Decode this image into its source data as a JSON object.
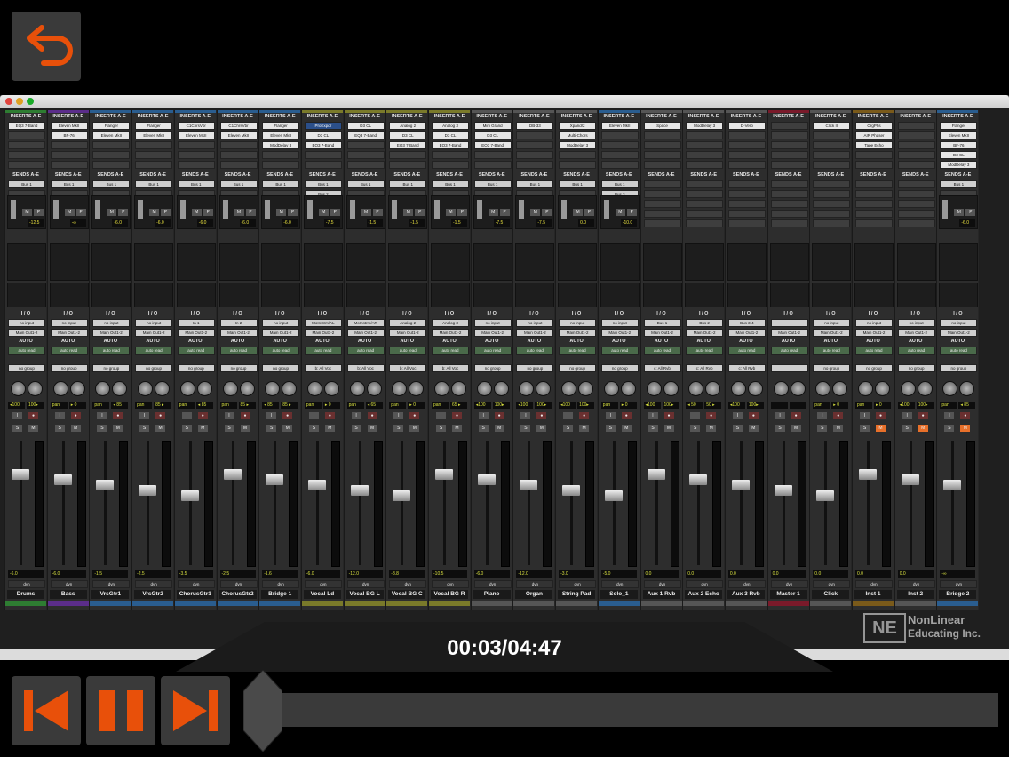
{
  "back_button": {
    "icon": "back-arrow-icon"
  },
  "mixer": {
    "insert_header": "INSERTS A-E",
    "sends_header": "SENDS A-E",
    "io_header": "I / O",
    "auto_header": "AUTO",
    "channels": [
      {
        "name": "Drums",
        "color": "#2e7d32",
        "inserts": [
          "EQ3 7-Band"
        ],
        "sends": [
          "Bus 1"
        ],
        "send_level": "-12.5",
        "input": "no input",
        "output": "Main Out1-2",
        "auto": "auto read",
        "group": "no group",
        "pan": [
          "◂100",
          "100▸"
        ],
        "vol": "-6.0",
        "mute_on": false
      },
      {
        "name": "Bass",
        "color": "#5b2d8a",
        "inserts": [
          "Eleven MkII",
          "BF-76"
        ],
        "sends": [
          "Bus 1"
        ],
        "send_level": "-∞",
        "input": "no input",
        "output": "Main Out1-2",
        "auto": "auto read",
        "group": "no group",
        "pan": [
          "pan",
          "▸ 0"
        ],
        "vol": "-6.0",
        "mute_on": false
      },
      {
        "name": "VrsGtr1",
        "color": "#2a5d8f",
        "inserts": [
          "Flanger",
          "Eleven MkII"
        ],
        "sends": [
          "Bus 1"
        ],
        "send_level": "-6.0",
        "input": "no input",
        "output": "Main Out1-2",
        "auto": "auto read",
        "group": "no group",
        "pan": [
          "pan",
          "◂ 85"
        ],
        "vol": "-1.5",
        "mute_on": false
      },
      {
        "name": "VrsGtr2",
        "color": "#2a5d8f",
        "inserts": [
          "Flanger",
          "Eleven MkII"
        ],
        "sends": [
          "Bus 1"
        ],
        "send_level": "-6.0",
        "input": "no input",
        "output": "Main Out1-2",
        "auto": "auto read",
        "group": "no group",
        "pan": [
          "pan",
          "85 ▸"
        ],
        "vol": "-2.5",
        "mute_on": false
      },
      {
        "name": "ChorusGtr1",
        "color": "#2a5d8f",
        "inserts": [
          "C1ChrsVbr",
          "Eleven MkII"
        ],
        "sends": [
          "Bus 1"
        ],
        "send_level": "-6.0",
        "input": "In 1",
        "output": "Main Out1-2",
        "auto": "auto read",
        "group": "no group",
        "pan": [
          "pan",
          "◂ 85"
        ],
        "vol": "-3.5",
        "mute_on": false
      },
      {
        "name": "ChorusGtr2",
        "color": "#2a5d8f",
        "inserts": [
          "C1ChrsVbr",
          "Eleven MkII"
        ],
        "sends": [
          "Bus 1"
        ],
        "send_level": "-6.0",
        "input": "In 2",
        "output": "Main Out1-2",
        "auto": "auto read",
        "group": "no group",
        "pan": [
          "pan",
          "85 ▸"
        ],
        "vol": "-2.5",
        "mute_on": false
      },
      {
        "name": "Bridge 1",
        "color": "#2a5d8f",
        "inserts": [
          "Flanger",
          "Eleven MkII",
          "ModDelay 3"
        ],
        "sends": [
          "Bus 1"
        ],
        "send_level": "-6.0",
        "input": "no input",
        "output": "Main Out1-2",
        "auto": "auto read",
        "group": "no group",
        "pan": [
          "◂ 85",
          "85 ▸"
        ],
        "vol": "-1.6",
        "mute_on": false
      },
      {
        "name": "Vocal Ld",
        "color": "#7a7a2a",
        "inserts": [
          "ProExpdr",
          "D3 CL",
          "EQ3 7-Band"
        ],
        "sends": [
          "Bus 1",
          "Bus 2"
        ],
        "send_level": "-7.5",
        "input": "MoInstrm/AL",
        "output": "Main Out1-2",
        "auto": "auto read",
        "group": "b: All Voc",
        "pan": [
          "pan",
          "▸ 0"
        ],
        "vol": "-6.0",
        "mute_on": false
      },
      {
        "name": "Vocal BG L",
        "color": "#7a7a2a",
        "inserts": [
          "D3 CL",
          "EQ3 7-Band"
        ],
        "sends": [
          "Bus 1"
        ],
        "send_level": "-1.5",
        "input": "MoInstrm/AR",
        "output": "Main Out1-2",
        "auto": "auto read",
        "group": "b: All Voc",
        "pan": [
          "pan",
          "◂ 65"
        ],
        "vol": "-12.0",
        "mute_on": false
      },
      {
        "name": "Vocal BG C",
        "color": "#7a7a2a",
        "inserts": [
          "Analog 2",
          "D3 CL",
          "EQ3 7-Band"
        ],
        "sends": [
          "Bus 1"
        ],
        "send_level": "-1.5",
        "input": "Analog 2",
        "output": "Main Out1-2",
        "auto": "auto read",
        "group": "b: All Voc",
        "pan": [
          "pan",
          "▸ 0"
        ],
        "vol": "-8.8",
        "mute_on": false
      },
      {
        "name": "Vocal BG R",
        "color": "#7a7a2a",
        "inserts": [
          "Analog 3",
          "D3 CL",
          "EQ3 7-Band"
        ],
        "sends": [
          "Bus 1"
        ],
        "send_level": "-1.5",
        "input": "Analog 3",
        "output": "Main Out1-2",
        "auto": "auto read",
        "group": "b: All Voc",
        "pan": [
          "pan",
          "65 ▸"
        ],
        "vol": "-10.5",
        "mute_on": false
      },
      {
        "name": "Piano",
        "color": "#555555",
        "inserts": [
          "Mini Grand",
          "D3 CL",
          "EQ3 7-Band"
        ],
        "sends": [
          "Bus 1"
        ],
        "send_level": "-7.5",
        "input": "no input",
        "output": "Main Out1-2",
        "auto": "auto read",
        "group": "no group",
        "pan": [
          "◂100",
          "100▸"
        ],
        "vol": "-6.0",
        "mute_on": false
      },
      {
        "name": "Organ",
        "color": "#555555",
        "inserts": [
          "DB-33"
        ],
        "sends": [
          "Bus 1"
        ],
        "send_level": "-7.5",
        "input": "no input",
        "output": "Main Out1-2",
        "auto": "auto read",
        "group": "no group",
        "pan": [
          "◂100",
          "100▸"
        ],
        "vol": "-12.0",
        "mute_on": false
      },
      {
        "name": "String Pad",
        "color": "#555555",
        "inserts": [
          "Xpand!2",
          "Multi-Chors",
          "ModDelay 3"
        ],
        "sends": [
          "Bus 1"
        ],
        "send_level": "0.0",
        "input": "no input",
        "output": "Main Out1-2",
        "auto": "auto read",
        "group": "no group",
        "pan": [
          "◂100",
          "100▸"
        ],
        "vol": "-3.0",
        "mute_on": false
      },
      {
        "name": "Solo_1",
        "color": "#2a5d8f",
        "inserts": [
          "Eleven MkII"
        ],
        "sends": [
          "Bus 1",
          "Bus 3"
        ],
        "send_level": "-10.0",
        "input": "no input",
        "output": "Main Out1-2",
        "auto": "auto read",
        "group": "no group",
        "pan": [
          "pan",
          "▸ 0"
        ],
        "vol": "-5.0",
        "mute_on": false
      },
      {
        "name": "Aux 1 Rvb",
        "color": "#555555",
        "inserts": [
          "Space"
        ],
        "sends": [],
        "send_level": "",
        "input": "Bus 1",
        "output": "Main Out1-2",
        "auto": "auto read",
        "group": "c: All Rvb",
        "pan": [
          "◂100",
          "100▸"
        ],
        "vol": "0.0",
        "mute_on": false
      },
      {
        "name": "Aux 2 Echo",
        "color": "#555555",
        "inserts": [
          "ModDelay 3"
        ],
        "sends": [],
        "send_level": "",
        "input": "Bus 2",
        "output": "Main Out1-2",
        "auto": "auto read",
        "group": "c: All Rvb",
        "pan": [
          "◂ 50",
          "50 ▸"
        ],
        "vol": "0.0",
        "mute_on": false
      },
      {
        "name": "Aux 3 Rvb",
        "color": "#555555",
        "inserts": [
          "D-Verb"
        ],
        "sends": [],
        "send_level": "",
        "input": "Bus 3-4",
        "output": "Main Out1-2",
        "auto": "auto read",
        "group": "c: All Rvb",
        "pan": [
          "◂100",
          "100▸"
        ],
        "vol": "0.0",
        "mute_on": false
      },
      {
        "name": "Master 1",
        "color": "#7a1a2a",
        "inserts": [],
        "sends": [],
        "send_level": "",
        "input": "",
        "output": "Main Out1-2",
        "auto": "auto read",
        "group": "",
        "pan": [
          "",
          ""
        ],
        "vol": "0.0",
        "mute_on": false
      },
      {
        "name": "Click",
        "color": "#555555",
        "inserts": [
          "Click II"
        ],
        "sends": [],
        "send_level": "",
        "input": "no input",
        "output": "Main Out1-2",
        "auto": "auto read",
        "group": "no group",
        "pan": [
          "pan",
          "▸ 0"
        ],
        "vol": "0.0",
        "mute_on": false
      },
      {
        "name": "Inst 1",
        "color": "#7a5a1a",
        "inserts": [
          "OrgPhs",
          "AIR Phaser",
          "Tape Echo"
        ],
        "sends": [],
        "send_level": "",
        "input": "no input",
        "output": "Main Out1-2",
        "auto": "auto read",
        "group": "no group",
        "pan": [
          "pan",
          "▸ 0"
        ],
        "vol": "0.0",
        "mute_on": true
      },
      {
        "name": "Inst 2",
        "color": "#555555",
        "inserts": [],
        "sends": [],
        "send_level": "",
        "input": "no input",
        "output": "Main Out1-2",
        "auto": "auto read",
        "group": "no group",
        "pan": [
          "◂100",
          "100▸"
        ],
        "vol": "0.0",
        "mute_on": true
      },
      {
        "name": "Bridge 2",
        "color": "#2a5d8f",
        "inserts": [
          "Flanger",
          "Eleven MkII",
          "BF-76",
          "D3 CL",
          "ModDelay 3"
        ],
        "sends": [
          "Bus 1"
        ],
        "send_level": "-6.0",
        "input": "no input",
        "output": "Main Out1-2",
        "auto": "auto read",
        "group": "no group",
        "pan": [
          "pan",
          "◂ 85"
        ],
        "vol": "-∞",
        "mute_on": true
      }
    ]
  },
  "watermark": {
    "logo": "NE",
    "line1": "NonLinear",
    "line2": "Educating Inc."
  },
  "player": {
    "time": "00:03/04:47",
    "progress": 0.01,
    "prev_icon": "skip-previous-icon",
    "pause_icon": "pause-icon",
    "next_icon": "skip-next-icon",
    "accent": "#e8500a"
  }
}
